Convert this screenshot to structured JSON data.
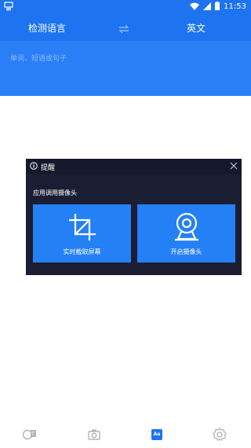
{
  "status_bar": {
    "time": "11:53"
  },
  "header": {
    "source_lang": "检测语言",
    "target_lang": "英文",
    "input_placeholder": "单词，短语或句子"
  },
  "dialog": {
    "title": "提醒",
    "subtitle": "应用调用摄像头",
    "options": [
      {
        "label": "实时截取屏幕"
      },
      {
        "label": "开启摄像头"
      }
    ]
  },
  "tabbar": {
    "aa_label": "Aa"
  },
  "colors": {
    "primary": "#1e74f0",
    "dialog_bg": "#1b1d33",
    "option_bg": "#2480f5"
  }
}
